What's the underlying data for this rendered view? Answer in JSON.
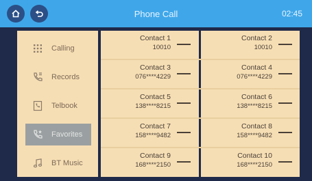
{
  "header": {
    "title": "Phone Call",
    "clock": "02:45"
  },
  "menu": [
    {
      "label": "Calling",
      "icon": "dialpad-icon",
      "selected": false
    },
    {
      "label": "Records",
      "icon": "call-records-icon",
      "selected": false
    },
    {
      "label": "Telbook",
      "icon": "phonebook-icon",
      "selected": false
    },
    {
      "label": "Favorites",
      "icon": "favorites-icon",
      "selected": true
    },
    {
      "label": "BT Music",
      "icon": "music-note-icon",
      "selected": false
    }
  ],
  "contacts": [
    {
      "name": "Contact 1",
      "number": "10010"
    },
    {
      "name": "Contact 2",
      "number": "10010"
    },
    {
      "name": "Contact 3",
      "number": "076****4229"
    },
    {
      "name": "Contact 4",
      "number": "076****4229"
    },
    {
      "name": "Contact 5",
      "number": "138****8215"
    },
    {
      "name": "Contact 6",
      "number": "138****8215"
    },
    {
      "name": "Contact 7",
      "number": "158****9482"
    },
    {
      "name": "Contact 8",
      "number": "158****9482"
    },
    {
      "name": "Contact 9",
      "number": "168****2150"
    },
    {
      "name": "Contact 10",
      "number": "168****2150"
    }
  ],
  "colors": {
    "topbar": "#3fa7e9",
    "panel": "#f6deb4",
    "background": "#1f2a4a",
    "selected": "#9aa0a1"
  }
}
